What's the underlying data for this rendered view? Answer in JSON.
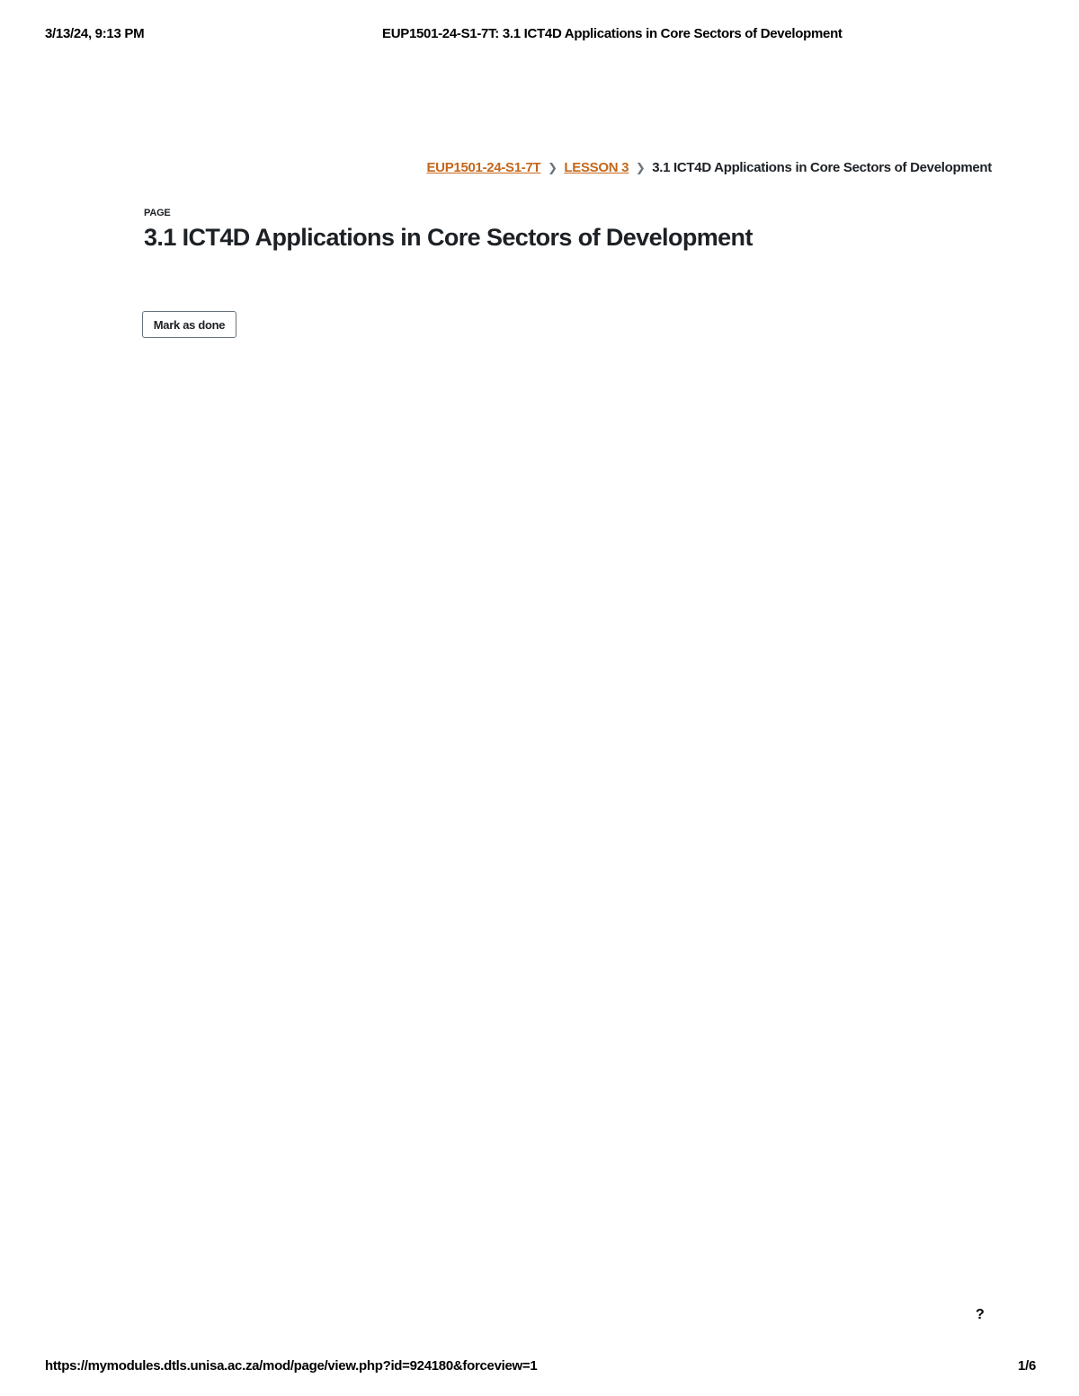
{
  "print_header": {
    "datetime": "3/13/24, 9:13 PM",
    "document_title": "EUP1501-24-S1-7T: 3.1 ICT4D Applications in Core Sectors of Development"
  },
  "breadcrumb": {
    "items": [
      {
        "label": "EUP1501-24-S1-7T",
        "link": true
      },
      {
        "label": "LESSON 3",
        "link": true
      },
      {
        "label": "3.1 ICT4D Applications in Core Sectors of Development",
        "link": false
      }
    ],
    "separator": "❯"
  },
  "activity": {
    "type_label": "PAGE",
    "title": "3.1 ICT4D Applications in Core Sectors of Development"
  },
  "completion": {
    "mark_done_label": "Mark as done"
  },
  "help": {
    "icon": "question-icon",
    "glyph": "?"
  },
  "print_footer": {
    "url": "https://mymodules.dtls.unisa.ac.za/mod/page/view.php?id=924180&forceview=1",
    "page_indicator": "1/6"
  },
  "colors": {
    "link": "#c4671b",
    "text": "#1d2125",
    "border": "#6a737b"
  }
}
